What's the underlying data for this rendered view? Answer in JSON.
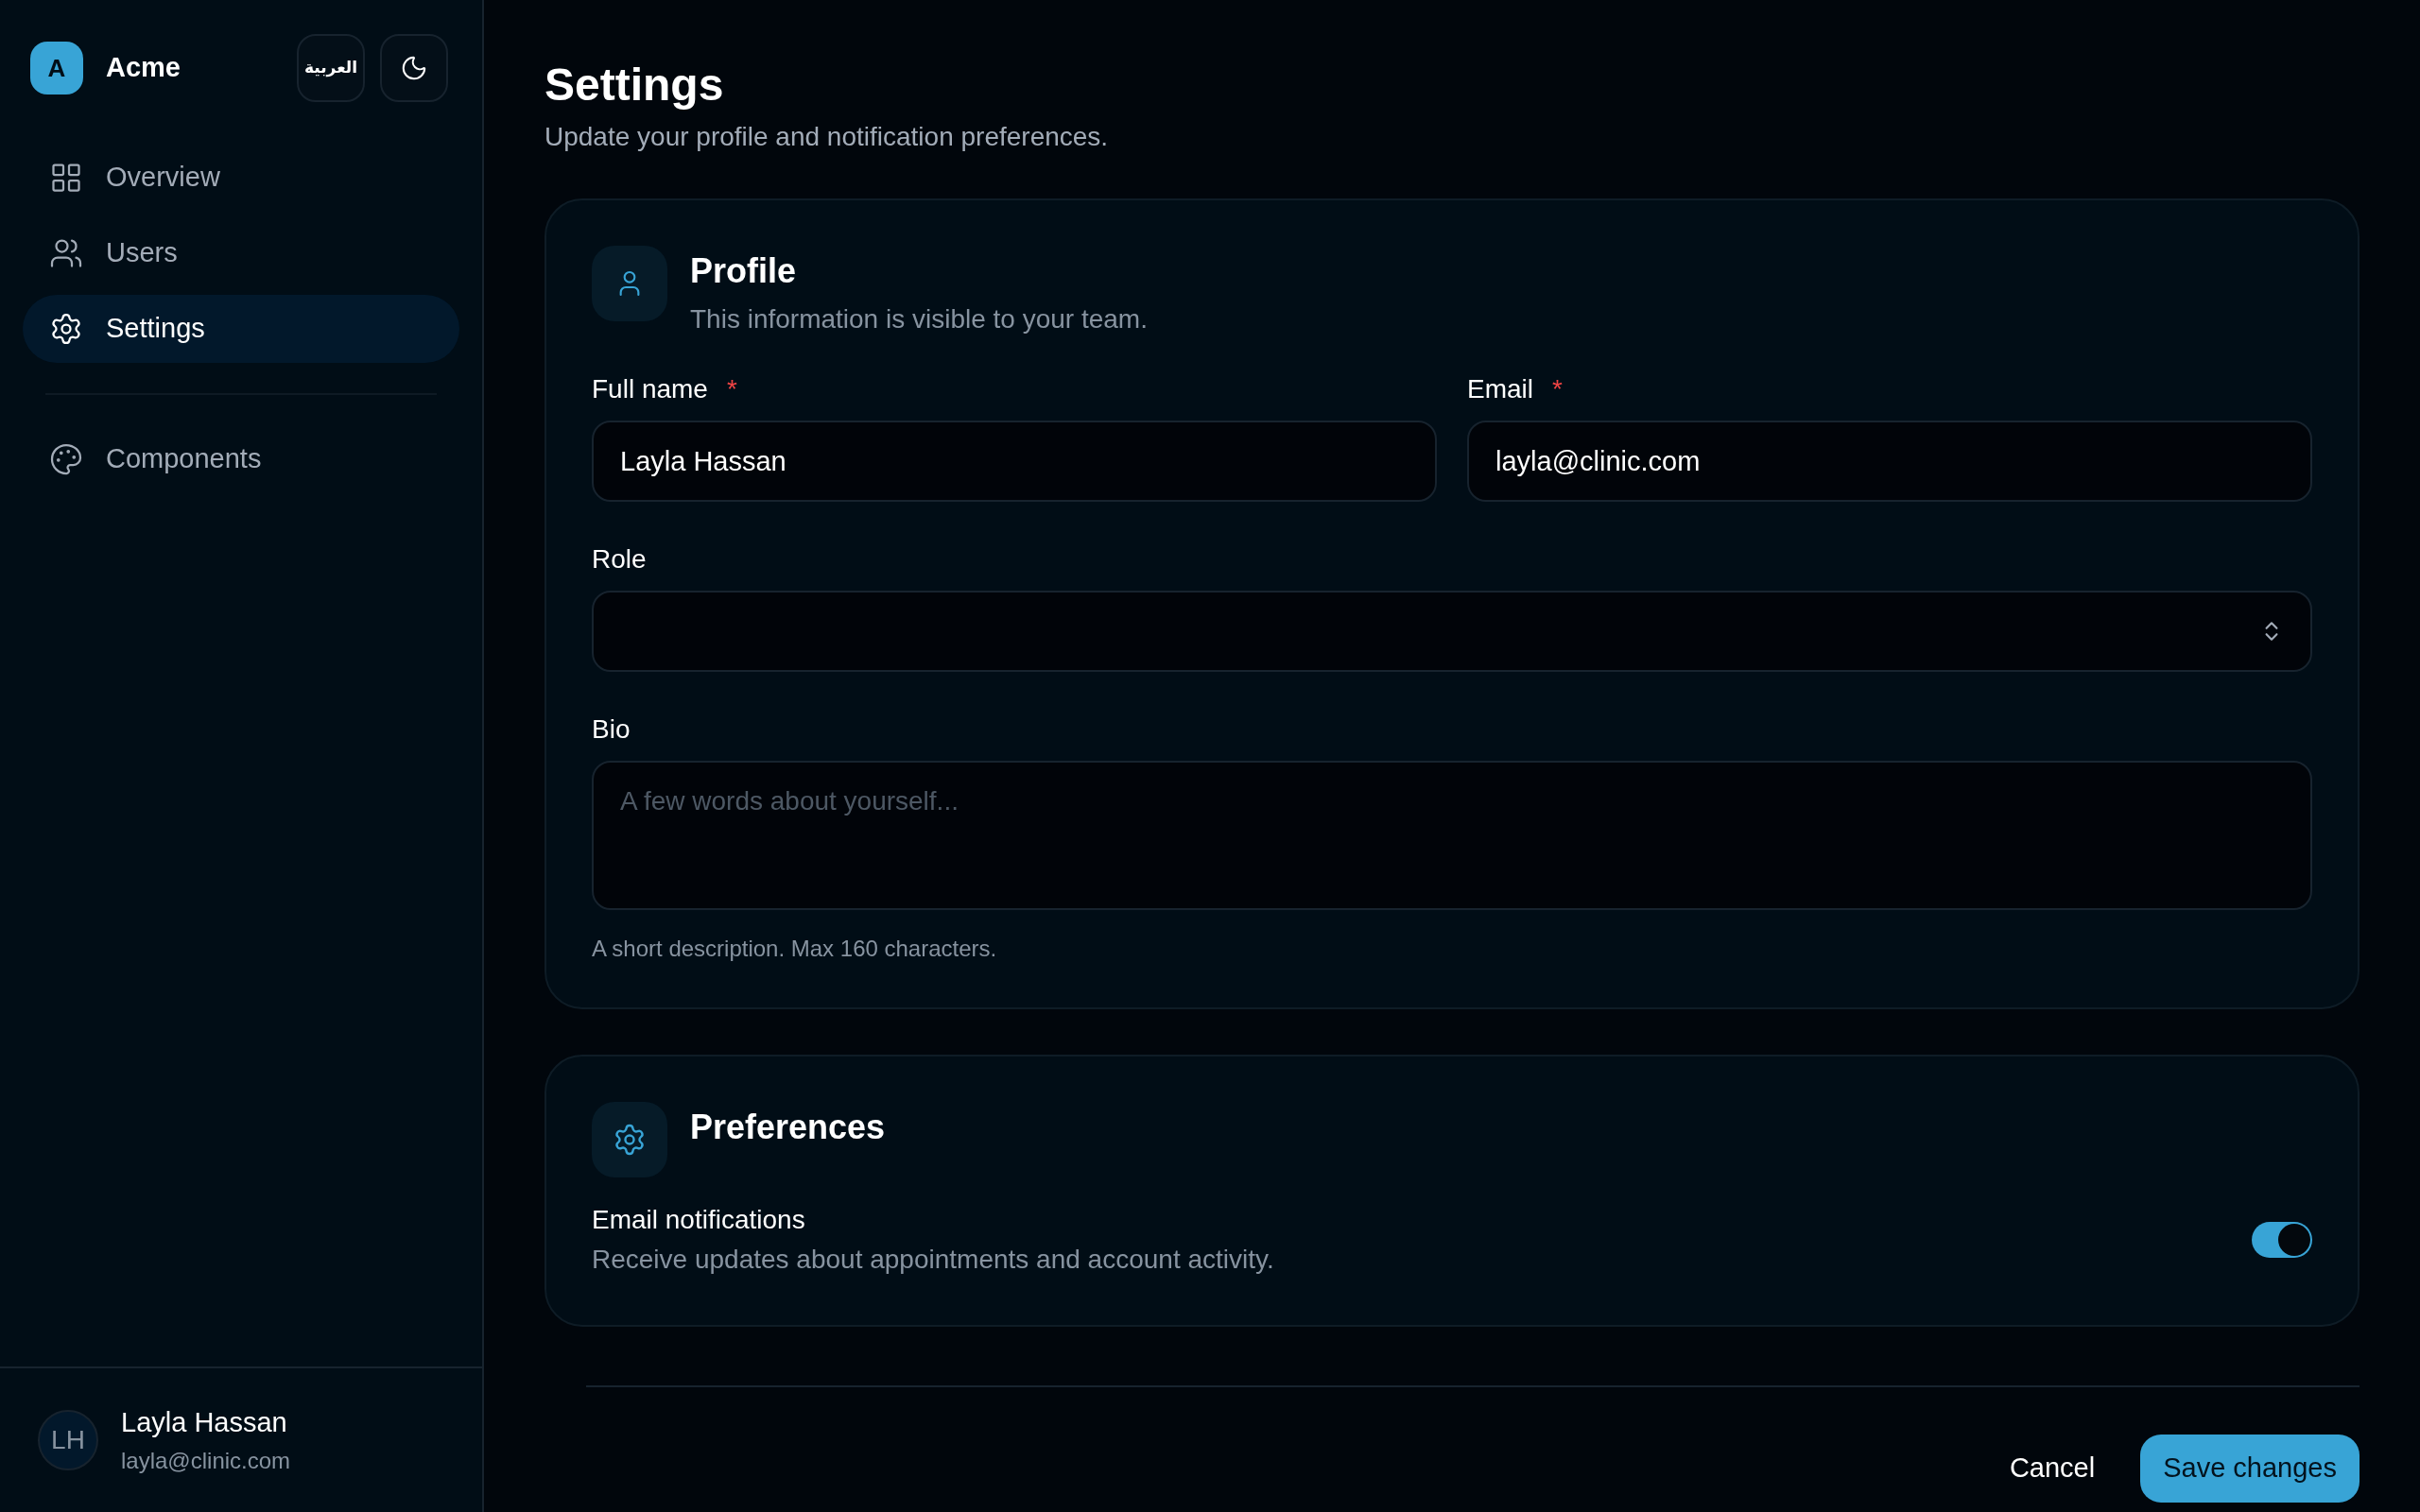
{
  "sidebar": {
    "brand": {
      "initial": "A",
      "name": "Acme"
    },
    "language_button": "العربية",
    "items": [
      {
        "kind": "overview",
        "label": "Overview",
        "selected": false
      },
      {
        "kind": "users",
        "label": "Users",
        "selected": false
      },
      {
        "kind": "settings",
        "label": "Settings",
        "selected": true
      }
    ],
    "secondary_items": [
      {
        "kind": "components",
        "label": "Components",
        "selected": false
      }
    ],
    "user": {
      "initials": "LH",
      "name": "Layla Hassan",
      "email": "layla@clinic.com"
    }
  },
  "page": {
    "title": "Settings",
    "subtitle": "Update your profile and notification preferences."
  },
  "profile": {
    "title": "Profile",
    "description": "This information is visible to your team.",
    "fields": [
      {
        "kind": "text",
        "label": "Full name",
        "required_mark": "*",
        "value": "Layla Hassan"
      },
      {
        "kind": "text",
        "label": "Email",
        "required_mark": "*",
        "value": "layla@clinic.com"
      },
      {
        "kind": "select",
        "label": "Role"
      },
      {
        "kind": "textarea",
        "label": "Bio",
        "placeholder": "A few words about yourself...",
        "hint": "A short description. Max 160 characters."
      }
    ]
  },
  "preferences": {
    "title": "Preferences",
    "items": [
      {
        "label": "Email notifications",
        "description": "Receive updates about appointments and account activity.",
        "on": true
      }
    ]
  },
  "actions": {
    "cancel": "Cancel",
    "save": "Save changes"
  }
}
